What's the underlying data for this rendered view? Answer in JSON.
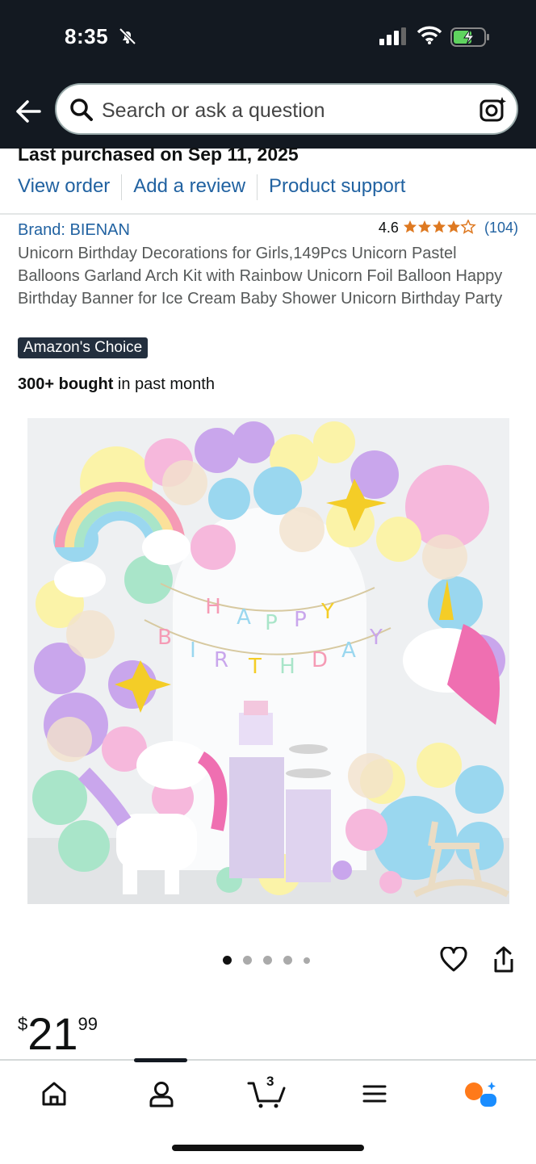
{
  "status_bar": {
    "time": "8:35"
  },
  "search": {
    "placeholder": "Search or ask a question"
  },
  "order": {
    "last_purchased": "Last purchased on Sep 11, 2025",
    "view_order": "View order",
    "add_review": "Add a review",
    "product_support": "Product support"
  },
  "product": {
    "brand": "Brand: BIENAN",
    "rating": "4.6",
    "stars_value": 4.6,
    "review_count": "(104)",
    "title": "Unicorn Birthday Decorations for Girls,149Pcs Unicorn Pastel Balloons Garland Arch Kit with Rainbow Unicorn Foil Balloon Happy Birthday Banner for Ice Cream Baby Shower Unicorn Birthday Party",
    "badge": "Amazon's Choice",
    "bought_bold": "300+ bought",
    "bought_rest": " in past month",
    "image_count": 5,
    "active_image": 1,
    "banner_top": "HAPPY",
    "banner_bottom": "BIRTHDAY",
    "price_currency": "$",
    "price_whole": "21",
    "price_fraction": "99"
  },
  "tabbar": {
    "cart_count": "3"
  },
  "colors": {
    "header_bg": "#131921",
    "link": "#2162a1",
    "star": "#de7921",
    "alexa": "#ff7a1a"
  }
}
